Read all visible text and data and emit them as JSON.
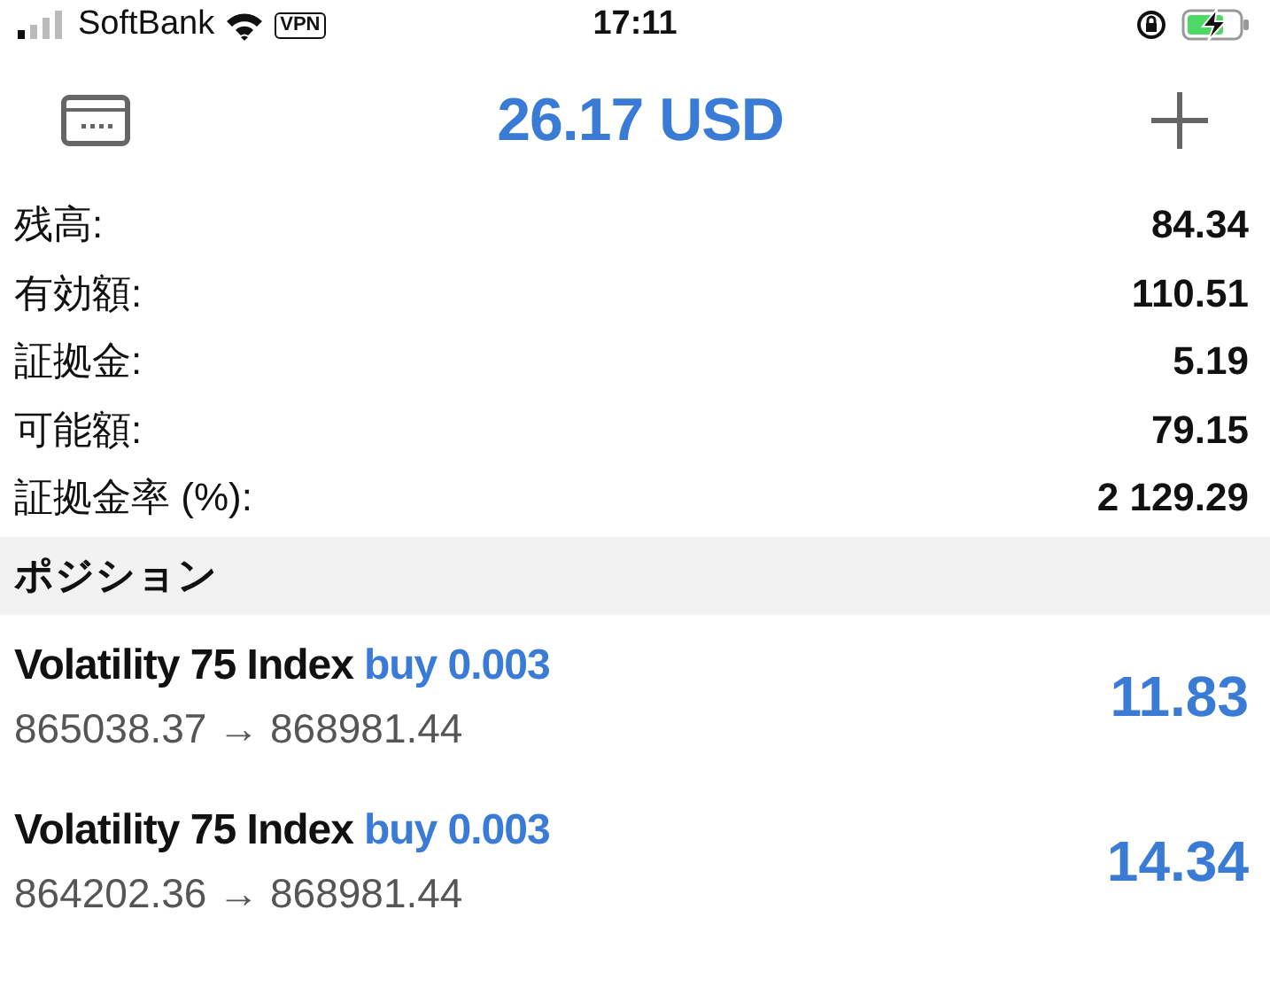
{
  "status_bar": {
    "carrier": "SoftBank",
    "vpn": "VPN",
    "time": "17:11"
  },
  "header": {
    "title": "26.17 USD"
  },
  "summary": [
    {
      "label": "残高:",
      "value": "84.34"
    },
    {
      "label": "有効額:",
      "value": "110.51"
    },
    {
      "label": "証拠金:",
      "value": "5.19"
    },
    {
      "label": "可能額:",
      "value": "79.15"
    },
    {
      "label": "証拠金率 (%):",
      "value": "2 129.29"
    }
  ],
  "positions_section": {
    "title": "ポジション"
  },
  "positions": [
    {
      "symbol": "Volatility 75 Index",
      "order": "buy 0.003",
      "prices": "865038.37 → 868981.44",
      "profit": "11.83"
    },
    {
      "symbol": "Volatility 75 Index",
      "order": "buy 0.003",
      "prices": "864202.36 → 868981.44",
      "profit": "14.34"
    }
  ]
}
